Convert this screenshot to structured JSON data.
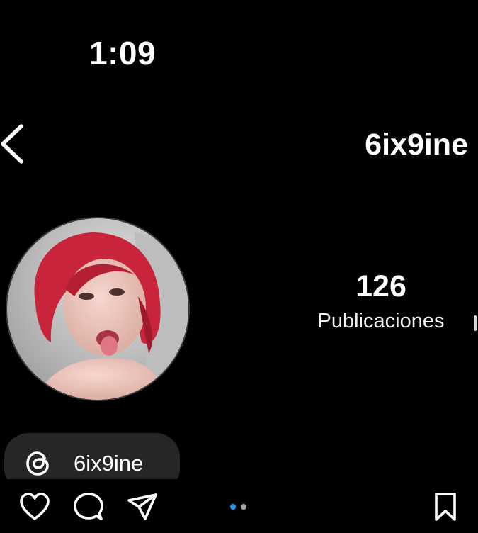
{
  "status_bar": {
    "time": "1:09"
  },
  "header": {
    "back_icon": "chevron-left-icon",
    "title": "6ix9ine"
  },
  "profile": {
    "avatar_icon": "profile-photo",
    "stats": [
      {
        "value": "126",
        "label": "Publicaciones"
      }
    ]
  },
  "threads_badge": {
    "icon": "threads-icon",
    "label": "6ix9ine"
  },
  "action_bar": {
    "like_icon": "heart-icon",
    "comment_icon": "comment-icon",
    "share_icon": "paper-plane-icon",
    "save_icon": "bookmark-icon",
    "carousel_dots": {
      "count": 2,
      "active_index": 0
    }
  },
  "colors": {
    "background": "#000000",
    "text": "#ffffff",
    "badge_background": "#262626",
    "active_dot": "#1d9bf0",
    "inactive_dot": "#a8a8a8"
  }
}
